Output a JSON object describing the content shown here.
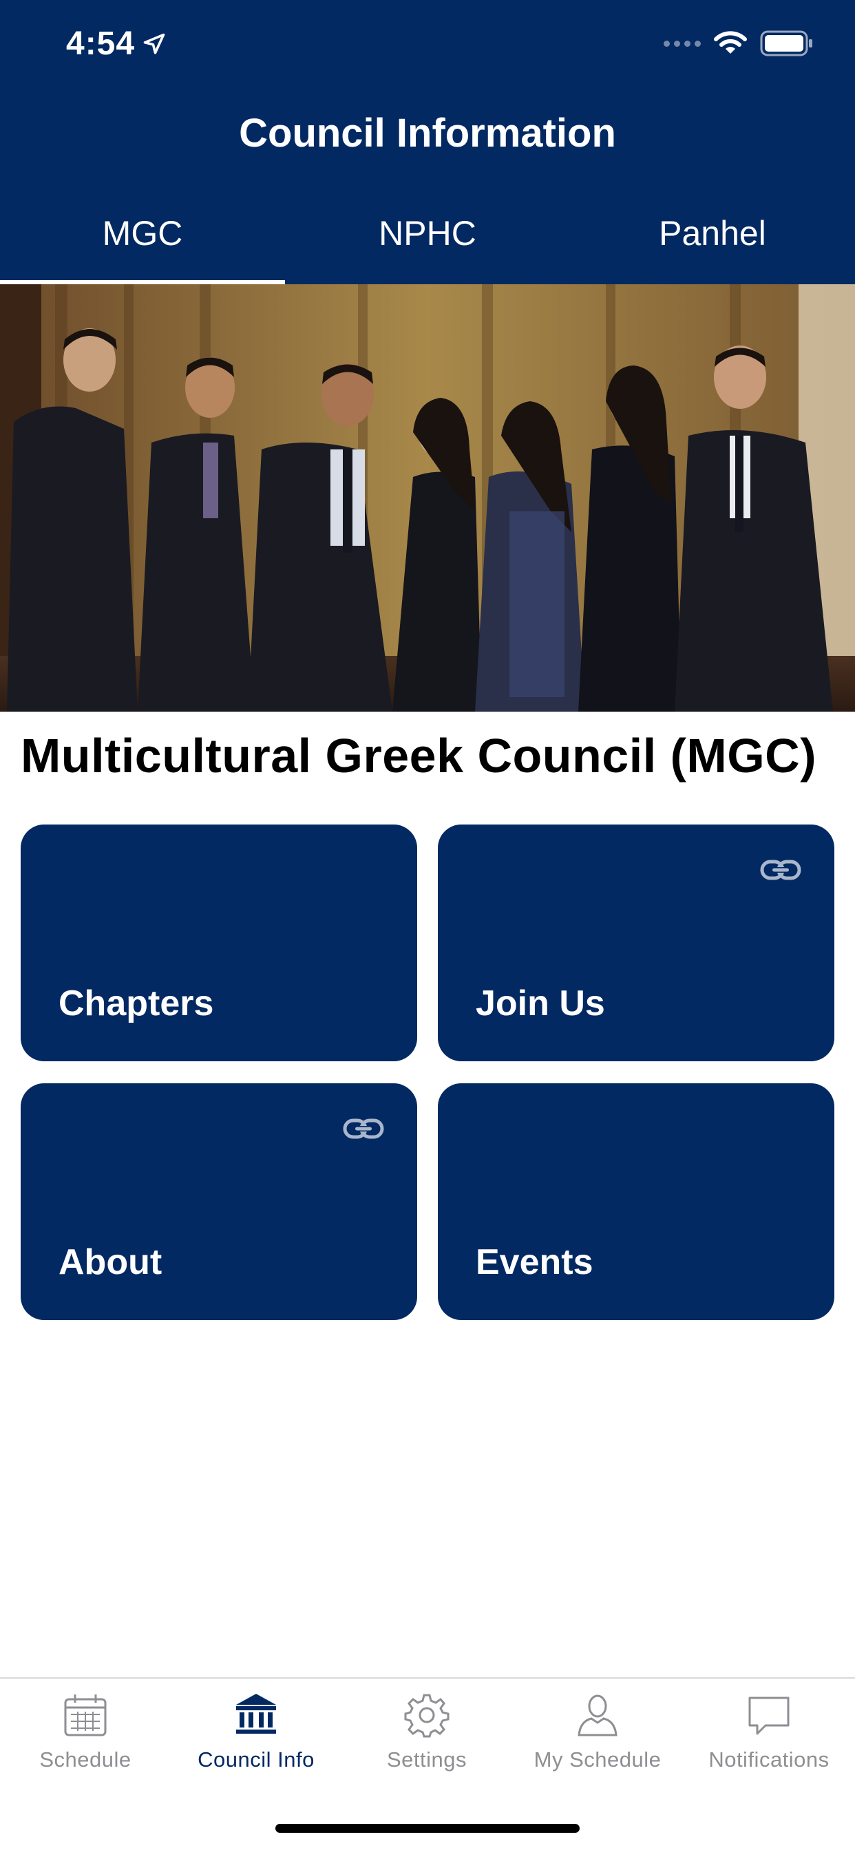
{
  "status_bar": {
    "time": "4:54"
  },
  "nav": {
    "title": "Council Information"
  },
  "tabs": [
    {
      "label": "MGC",
      "active": true
    },
    {
      "label": "NPHC",
      "active": false
    },
    {
      "label": "Panhel",
      "active": false
    }
  ],
  "council": {
    "title": "Multicultural Greek Council (MGC)"
  },
  "cards": [
    {
      "label": "Chapters",
      "has_link_icon": false
    },
    {
      "label": "Join Us",
      "has_link_icon": true
    },
    {
      "label": "About",
      "has_link_icon": true
    },
    {
      "label": "Events",
      "has_link_icon": false
    }
  ],
  "tab_bar": {
    "items": [
      {
        "label": "Schedule",
        "icon": "calendar-icon",
        "active": false
      },
      {
        "label": "Council Info",
        "icon": "institution-icon",
        "active": true
      },
      {
        "label": "Settings",
        "icon": "gear-icon",
        "active": false
      },
      {
        "label": "My Schedule",
        "icon": "person-icon",
        "active": false
      },
      {
        "label": "Notifications",
        "icon": "chat-bubble-icon",
        "active": false
      }
    ]
  },
  "colors": {
    "primary": "#032963",
    "inactive": "#8e8e93",
    "background": "#ffffff"
  }
}
